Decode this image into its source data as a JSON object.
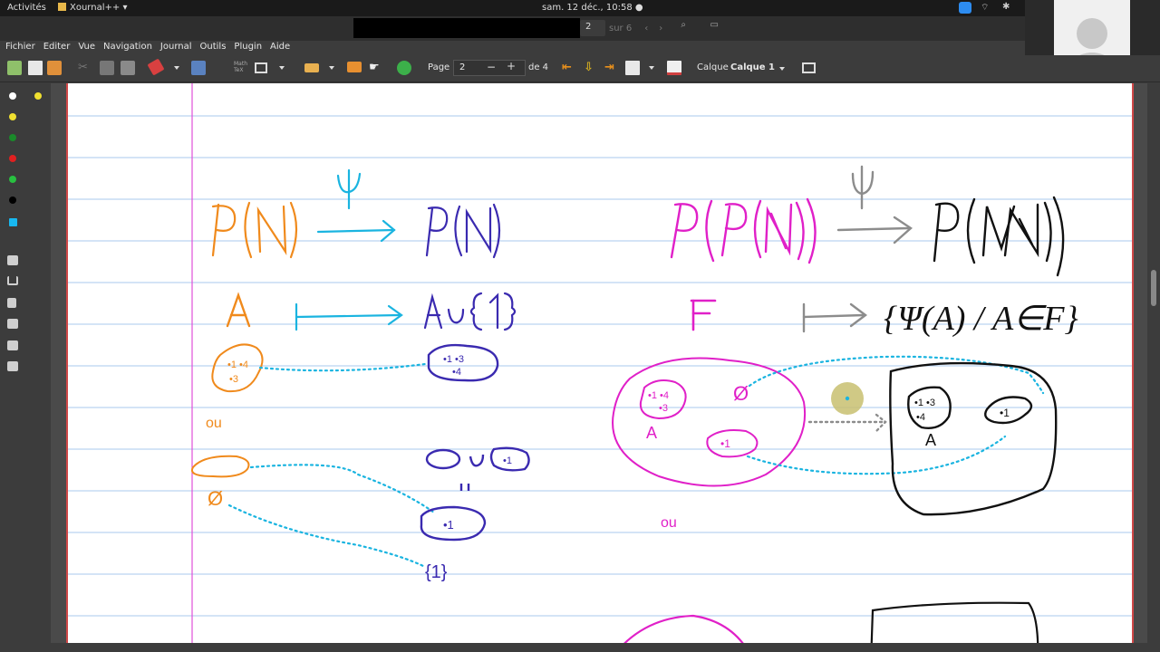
{
  "topbar": {
    "activities": "Activités",
    "app_name": "Xournal++",
    "clock": "sam. 12 déc., 10:58"
  },
  "page_search": {
    "current_page": "2",
    "of_text": "sur 6"
  },
  "menu": {
    "items": [
      "Fichier",
      "Editer",
      "Vue",
      "Navigation",
      "Journal",
      "Outils",
      "Plugin",
      "Aide"
    ]
  },
  "toolbar": {
    "page_label": "Page",
    "page_value": "2",
    "minus": "−",
    "plus": "+",
    "page_total": "de 4",
    "layer_label": "Calque",
    "layer_value": "Calque 1"
  },
  "colors": {
    "orange": "#f08a1c",
    "cyan": "#1ab4e0",
    "blue": "#3a2ab0",
    "magenta": "#e020c8",
    "gray": "#8c8c8c",
    "black": "#111111",
    "ruling": "#a9c8ec",
    "margin": "#e050d8",
    "border": "#d04848"
  },
  "notes": {
    "psi": "Ψ",
    "set_union": "A∪{1}",
    "ou": "ou",
    "set_one": "{1}",
    "psi_set": "{Ψ(A) / A∈F}"
  }
}
